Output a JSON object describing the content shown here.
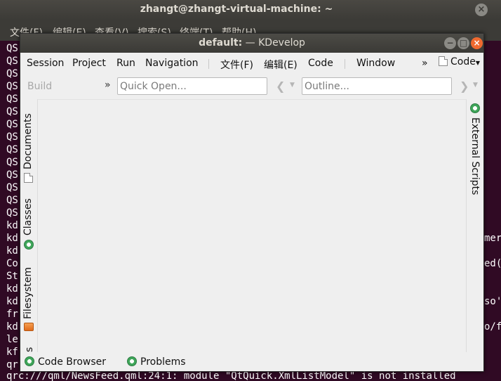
{
  "terminal": {
    "title": "zhangt@zhangt-virtual-machine: ~",
    "close_label": "×",
    "menu": [
      "文件(F)",
      "编辑(E)",
      "查看(V)",
      "搜索(S)",
      "终端(T)",
      "帮助(H)"
    ],
    "left_lines": [
      "QS",
      "QS",
      "QS",
      "QS",
      "QS",
      "QS",
      "QS",
      "QS",
      "QS",
      "QS",
      "QS",
      "QS",
      "QS",
      "QS",
      "kd",
      "kd",
      "kd",
      "Co",
      "St",
      "kd",
      "kd",
      "fr",
      "kd",
      "le",
      "kf",
      "qr"
    ],
    "right_fragments": [
      "mer",
      "ed((",
      "so'",
      "o/f"
    ],
    "last_line": "qrc:///qml/NewsFeed.qml:24:1: module \"QtQuick.XmlListModel\" is not installed"
  },
  "window": {
    "title_prefix": "default:",
    "title_app": " — KDevelop",
    "min_label": "−",
    "max_label": "□",
    "close_label": "×"
  },
  "menubar": {
    "items": [
      "Session",
      "Project",
      "Run",
      "Navigation",
      "文件(F)",
      "编辑(E)",
      "Code",
      "Window"
    ],
    "overflow": "»",
    "code_dropdown": "Code"
  },
  "toolbar": {
    "build_label": "Build",
    "overflow": "»",
    "quick_open_placeholder": "Quick Open...",
    "outline_placeholder": "Outline...",
    "back_glyph": "❮",
    "forward_glyph": "❯",
    "dropdown_glyph": "▼"
  },
  "left_dock": {
    "tabs": [
      "Documents",
      "Classes",
      "Filesystem"
    ],
    "partial_tab": "s"
  },
  "right_dock": {
    "tabs": [
      "External Scripts"
    ]
  },
  "bottom_dock": {
    "tabs": [
      "Code Browser",
      "Problems"
    ]
  },
  "colors": {
    "terminal_bg": "#300a24",
    "window_bg": "#efefef",
    "titlebar": "#3c3b37",
    "close_button": "#f0692f"
  },
  "icons": {
    "documents": "document-icon",
    "classes": "classes-icon",
    "filesystem": "folder-icon",
    "external_scripts": "scripts-icon",
    "code_browser": "code-browser-icon",
    "problems": "problems-icon"
  }
}
